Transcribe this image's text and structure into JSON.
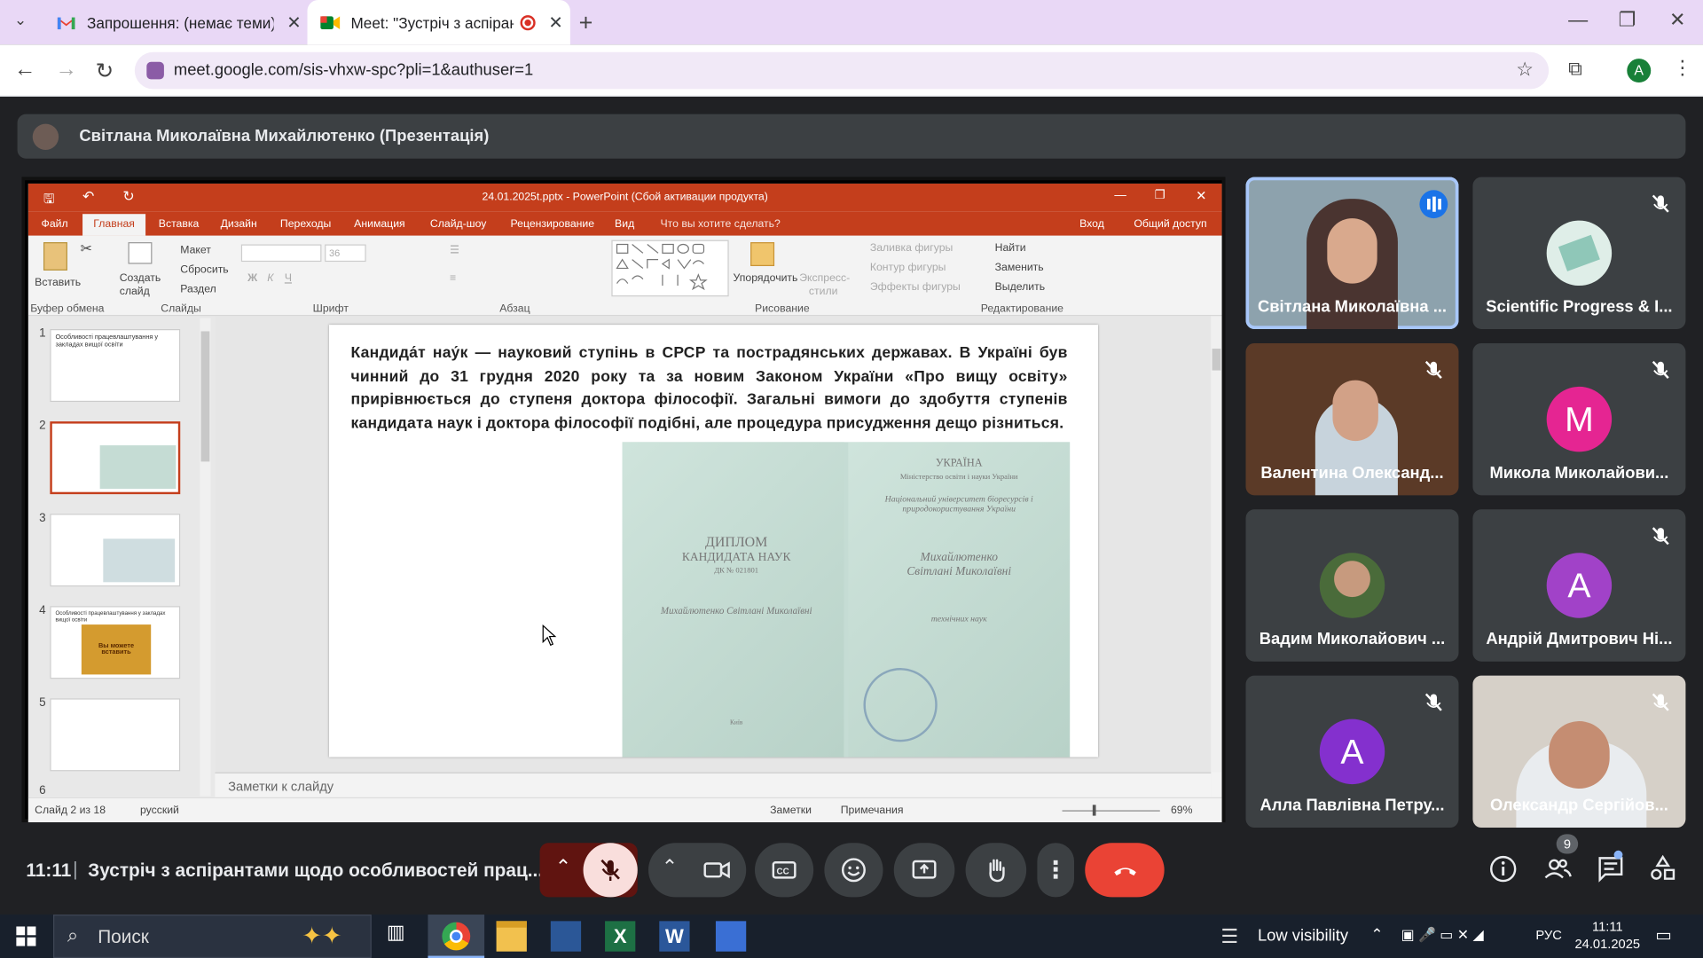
{
  "browser": {
    "tabs": [
      {
        "title": "Запрошення: (немає теми) @ "
      },
      {
        "title": "Meet: \"Зустріч з аспірантами"
      }
    ],
    "url": "meet.google.com/sis-vhxw-spc?pli=1&authuser=1",
    "profile_initial": "A"
  },
  "presentation": {
    "presenter": "Світлана Миколаївна Михайлютенко (Презентація)"
  },
  "powerpoint": {
    "title": "24.01.2025t.pptx - PowerPoint (Сбой активации продукта)",
    "menu": [
      "Файл",
      "Главная",
      "Вставка",
      "Дизайн",
      "Переходы",
      "Анимация",
      "Слайд-шоу",
      "Рецензирование",
      "Вид",
      "Что вы хотите сделать?",
      "Вход",
      "Общий доступ"
    ],
    "ribbon": {
      "paste": "Вставить",
      "new_slide": "Создать слайд",
      "layout": "Макет",
      "reset": "Сбросить",
      "section": "Раздел",
      "font_size": "36",
      "arrange": "Упорядочить",
      "express_styles": "Экспресс-стили",
      "shape_fill": "Заливка фигуры",
      "shape_outline": "Контур фигуры",
      "shape_effects": "Эффекты фигуры",
      "find": "Найти",
      "replace": "Заменить",
      "select": "Выделить",
      "groups": [
        "Буфер обмена",
        "Слайды",
        "Шрифт",
        "Абзац",
        "Рисование",
        "Редактирование"
      ]
    },
    "thumb_numbers": [
      "1",
      "2",
      "3",
      "4",
      "5",
      "6"
    ],
    "thumb1_title": "Особливості працевлаштування у закладах вищої освіти",
    "thumb4_title": "Особливості працевлаштування у закладах вищої освіти",
    "thumb4_book": "Вы можете вставить",
    "slide_text": "Кандида́т нау́к — науковий ступінь в СРСР та пострадянських державах. В Україні був чинний до 31 грудня 2020 року та за новим Законом України «Про вищу освіту» прирівнюється до ступеня доктора філософії. Загальні вимоги до здобуття ступенів кандидата наук і доктора філософії подібні, але процедура присудження дещо різниться.",
    "diploma": {
      "country": "УКРАЇНА",
      "ministry": "Міністерство освіти і науки України",
      "title_line1": "ДИПЛОМ",
      "title_line2": "КАНДИДАТА НАУК",
      "number": "ДК № 021801",
      "name_left": "Михайлютенко Світлані Миколаївні",
      "univ": "Національний університет біоресурсів і природокористування України",
      "name_right_1": "Михайлютенко",
      "name_right_2": "Світлані Миколаївні",
      "science": "технічних наук",
      "specialty": "Київ"
    },
    "notes_placeholder": "Заметки к слайду",
    "status": {
      "slide_of": "Слайд 2 из 18",
      "language": "русский",
      "notes": "Заметки",
      "comments": "Примечания",
      "zoom": "69%"
    }
  },
  "participants": [
    {
      "name": "Світлана Миколаївна ...",
      "speaking": true
    },
    {
      "name": "Scientific Progress & I...",
      "muted": true
    },
    {
      "name": "Валентина Олександ...",
      "muted": true
    },
    {
      "name": "Микола Миколайови...",
      "initial": "M",
      "color": "#e52592",
      "muted": true
    },
    {
      "name": "Вадим Миколайович ...",
      "muted": false
    },
    {
      "name": "Андрій Дмитрович Ні...",
      "initial": "A",
      "color": "#a142c8",
      "muted": true
    },
    {
      "name": "Алла Павлівна Петру...",
      "initial": "A",
      "color": "#8430ce",
      "muted": true
    },
    {
      "name": "Олександр Сергійов...",
      "muted": true
    }
  ],
  "meeting": {
    "time": "11:11",
    "separator": "|",
    "title": "Зустріч з аспірантами щодо особливостей прац...",
    "people_count": "9"
  },
  "taskbar": {
    "search": "Поиск",
    "weather": "Low visibility",
    "language": "РУС",
    "time": "11:11",
    "date": "24.01.2025"
  },
  "colors": {
    "ppt_accent": "#c43e1c",
    "meet_bg": "#202124",
    "end_call": "#ea4335",
    "mic_off_bg": "#f9dedc"
  }
}
